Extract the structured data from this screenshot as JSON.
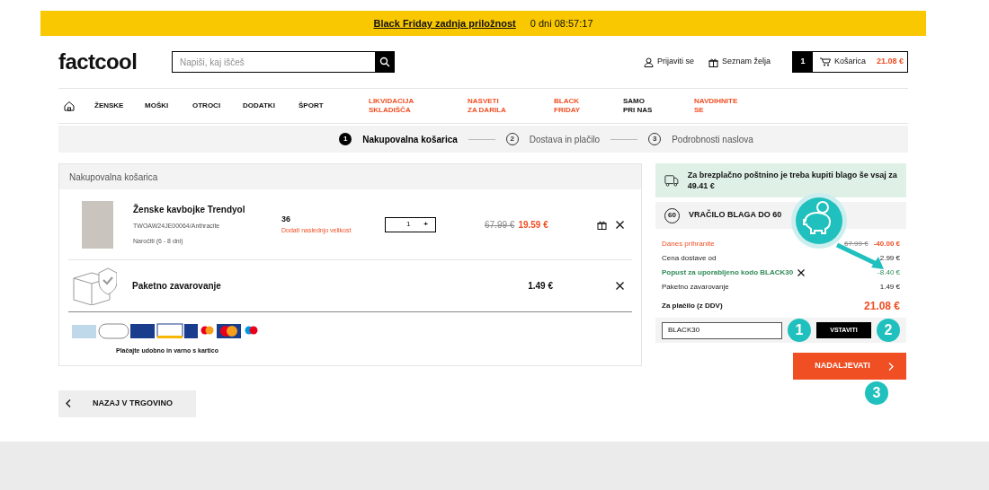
{
  "promo_bar": {
    "link": "Black Friday zadnja priložnost",
    "countdown": "0 dni 08:57:17"
  },
  "header": {
    "logo": "factcool",
    "search": {
      "placeholder": "Napiši, kaj iščeš"
    },
    "login": "Prijaviti se",
    "wishlist": "Seznam želja",
    "cart": {
      "count": "1",
      "label": "Košarica",
      "total": "21.08 €"
    }
  },
  "nav": [
    {
      "label": "ŽENSKE",
      "highlight": false
    },
    {
      "label": "MOŠKI",
      "highlight": false
    },
    {
      "label": "OTROCI",
      "highlight": false
    },
    {
      "label": "DODATKI",
      "highlight": false
    },
    {
      "label": "ŠPORT",
      "highlight": false
    },
    {
      "label": "LIKVIDACIJA SKLADIŠČA",
      "highlight": true
    },
    {
      "label": "NASVETI ZA DARILA",
      "highlight": true
    },
    {
      "label": "BLACK FRIDAY",
      "highlight": true
    },
    {
      "label": "SAMO PRI NAS",
      "highlight": false
    },
    {
      "label": "NAVDIHNITE SE",
      "highlight": true
    }
  ],
  "steps": [
    {
      "number": "1",
      "label": "Nakupovalna košarica",
      "selected": true
    },
    {
      "number": "2",
      "label": "Dostava in plačilo",
      "selected": false
    },
    {
      "number": "3",
      "label": "Podrobnosti naslova",
      "selected": false
    }
  ],
  "cart": {
    "title": "Nakupovalna košarica",
    "item": {
      "name": "Ženske kavbojke Trendyol",
      "code": "TWOAW24JE00064/Anthracite",
      "delivery": "Naročiti (6 - 8 dni)",
      "size": "36",
      "add_size": "Dodati naslednjo velikost",
      "quantity": "1",
      "plus": "+",
      "old_price": "67.99 €",
      "price": "19.59 €"
    },
    "insurance": {
      "name": "Paketno zavarovanje",
      "price": "1.49 €"
    },
    "payment_note": "Plačajte udobno in varno s kartico"
  },
  "back_button": "NAZAJ V TRGOVINO",
  "summary": {
    "free_shipping": "Za brezplačno poštnino je treba kupiti blago še vsaj za 49.41 €",
    "return_badge": "60",
    "return": "VRAČILO BLAGA DO 60",
    "lines": [
      {
        "kind": "savings",
        "label": "Danes prihranite",
        "old": "67.99 €",
        "value": "-40.00 €"
      },
      {
        "kind": "plain",
        "label": "Cena dostave od",
        "value": "2.99 €"
      },
      {
        "kind": "discount",
        "label": "Popust za uporabljeno kodo BLACK30",
        "value": "-8.40 €"
      },
      {
        "kind": "plain",
        "label": "Paketno zavarovanje",
        "value": "1.49 €"
      }
    ],
    "total": {
      "label": "Za plačilo (z DDV)",
      "value": "21.08 €"
    },
    "coupon": {
      "value": "BLACK30",
      "button": "VSTAVITI"
    },
    "continue": "NADALJEVATI"
  },
  "annotations": [
    {
      "number": "1"
    },
    {
      "number": "2"
    },
    {
      "number": "3"
    }
  ]
}
